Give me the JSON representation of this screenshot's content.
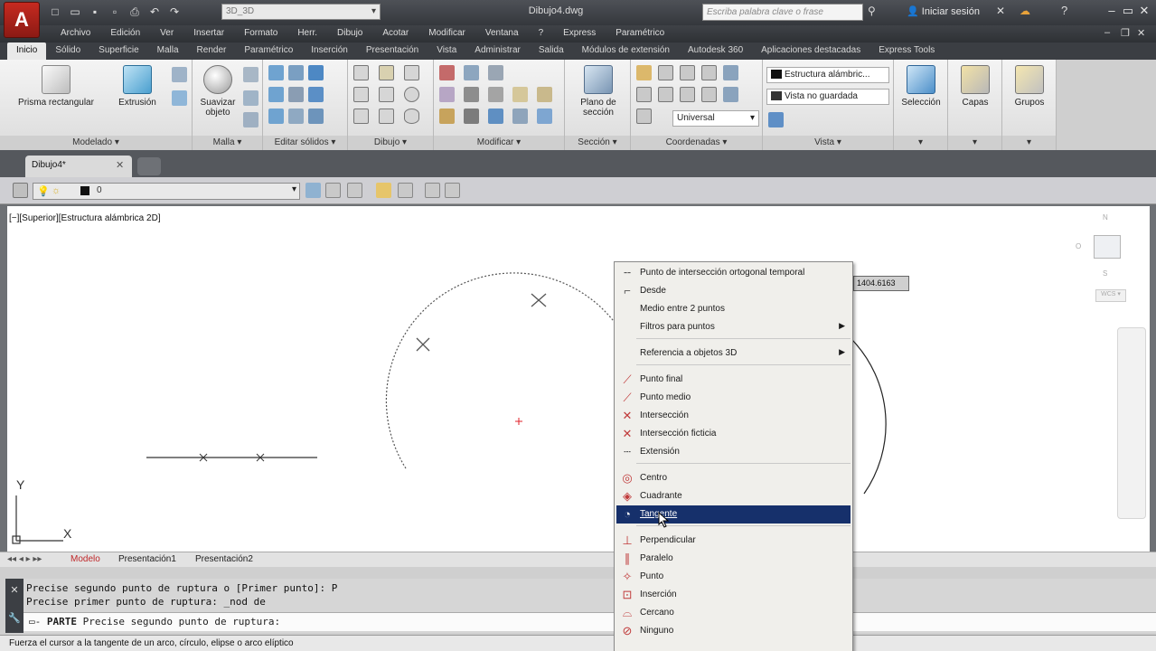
{
  "app": {
    "logo": "A",
    "doc_title": "Dibujo4.dwg",
    "workspace": "3D_3D",
    "search_placeholder": "Escriba palabra clave o frase",
    "login": "Iniciar sesión"
  },
  "menubar": [
    "Archivo",
    "Edición",
    "Ver",
    "Insertar",
    "Formato",
    "Herr.",
    "Dibujo",
    "Acotar",
    "Modificar",
    "Ventana",
    "?",
    "Express",
    "Paramétrico"
  ],
  "ribbon_tabs": [
    "Inicio",
    "Sólido",
    "Superficie",
    "Malla",
    "Render",
    "Paramétrico",
    "Inserción",
    "Presentación",
    "Vista",
    "Administrar",
    "Salida",
    "Módulos de extensión",
    "Autodesk 360",
    "Aplicaciones destacadas",
    "Express Tools"
  ],
  "ribbon": {
    "prisma": "Prisma rectangular",
    "extrusion": "Extrusión",
    "suavizar": "Suavizar objeto",
    "plano": "Plano de sección",
    "visual_style": "Estructura alámbric...",
    "view_state": "Vista no guardada",
    "ucs": "Universal",
    "seleccion": "Selección",
    "capas": "Capas",
    "grupos": "Grupos",
    "panels": {
      "modelado": "Modelado",
      "malla": "Malla",
      "editar_solidos": "Editar sólidos",
      "dibujo": "Dibujo",
      "modificar": "Modificar",
      "seccion": "Sección",
      "coordenadas": "Coordenadas",
      "vista": "Vista"
    }
  },
  "doctab": "Dibujo4*",
  "layer_value": "0",
  "viewport_label": "[−][Superior][Estructura alámbrica 2D]",
  "viewcube": {
    "n": "N",
    "o": "O",
    "s": "S",
    "wcs": "WCS"
  },
  "coord_tooltip": "1404.6163",
  "axis": {
    "y": "Y",
    "x": "X"
  },
  "layout_tabs": [
    "Modelo",
    "Presentación1",
    "Presentación2"
  ],
  "command": {
    "line1": "Precise segundo punto de ruptura o [Primer punto]: P",
    "line2": "Precise primer punto de ruptura: _nod de",
    "prompt_bold": "PARTE",
    "prompt": "Precise segundo punto de ruptura:"
  },
  "status": "Fuerza el cursor a la tangente de un arco, círculo, elipse o arco elíptico",
  "context_menu": [
    {
      "label": "Punto de intersección ortogonal temporal",
      "icon": "tracking-icon"
    },
    {
      "label": "Desde",
      "icon": "from-icon"
    },
    {
      "label": "Medio entre 2 puntos",
      "icon": ""
    },
    {
      "label": "Filtros para puntos",
      "icon": "",
      "submenu": true
    },
    {
      "label": "Referencia a objetos 3D",
      "icon": "",
      "submenu": true
    },
    {
      "label": "Punto final",
      "icon": "endpoint-icon"
    },
    {
      "label": "Punto medio",
      "icon": "midpoint-icon"
    },
    {
      "label": "Intersección",
      "icon": "intersection-icon"
    },
    {
      "label": "Intersección ficticia",
      "icon": "apparent-intersection-icon"
    },
    {
      "label": "Extensión",
      "icon": "extension-icon"
    },
    {
      "label": "Centro",
      "icon": "center-icon"
    },
    {
      "label": "Cuadrante",
      "icon": "quadrant-icon"
    },
    {
      "label": "Tangente",
      "icon": "tangent-icon"
    },
    {
      "label": "Perpendicular",
      "icon": "perpendicular-icon"
    },
    {
      "label": "Paralelo",
      "icon": "parallel-icon"
    },
    {
      "label": "Punto",
      "icon": "node-icon"
    },
    {
      "label": "Inserción",
      "icon": "insertion-icon"
    },
    {
      "label": "Cercano",
      "icon": "nearest-icon"
    },
    {
      "label": "Ninguno",
      "icon": "none-icon"
    }
  ],
  "colors": {
    "highlight": "#16306b",
    "accent_red": "#c62a20",
    "crosshair_red": "#e0202a"
  }
}
